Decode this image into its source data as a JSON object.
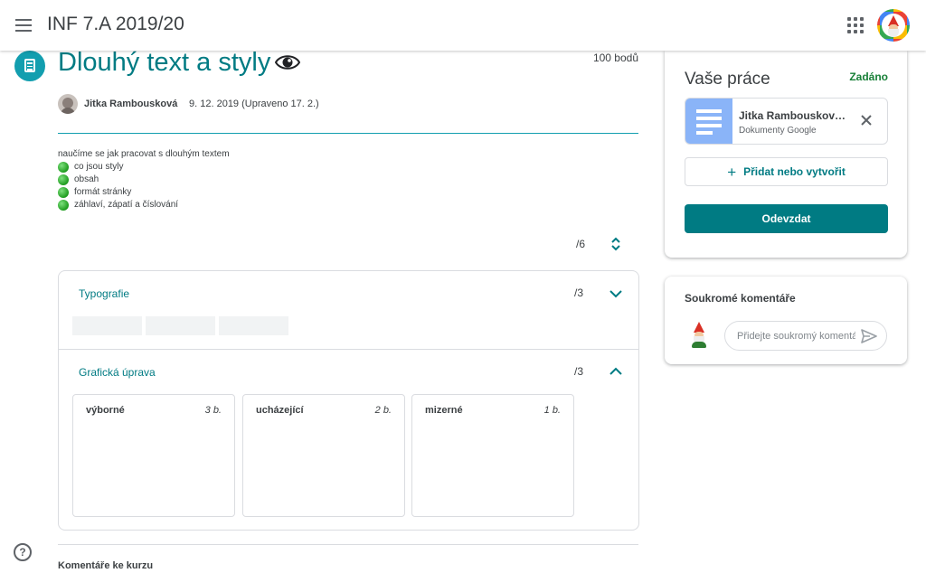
{
  "header": {
    "class_title": "INF 7.A 2019/20",
    "icons": {
      "menu": "menu-icon",
      "apps": "apps-grid-icon",
      "account": "account-avatar"
    }
  },
  "assignment": {
    "title": "Dlouhý text a styly",
    "points": "100 bodů",
    "author": "Jitka Rambousková",
    "date": "9. 12. 2019 (Upraveno 17. 2.)",
    "description_intro": "naučíme se jak pracovat s dlouhým textem",
    "bullets": [
      "co jsou styly",
      "obsah",
      "formát stránky",
      "záhlaví, zápatí a číslování"
    ]
  },
  "rubric": {
    "total": "/6",
    "criteria": [
      {
        "title": "Typografie",
        "score": "/3",
        "expanded": false
      },
      {
        "title": "Grafická úprava",
        "score": "/3",
        "expanded": true,
        "levels": [
          {
            "name": "výborné",
            "points": "3 b."
          },
          {
            "name": "ucházející",
            "points": "2 b."
          },
          {
            "name": "mizerné",
            "points": "1 b."
          }
        ]
      }
    ]
  },
  "course_comments": {
    "title": "Komentáře ke kurzu"
  },
  "your_work": {
    "title": "Vaše práce",
    "status": "Zadáno",
    "attachment": {
      "name": "Jitka Rambouskov…",
      "type": "Dokumenty Google"
    },
    "add_label": "Přidat nebo vytvořit",
    "submit_label": "Odevzdat"
  },
  "private_comments": {
    "title": "Soukromé komentáře",
    "placeholder": "Přidejte soukromý komentář…"
  },
  "colors": {
    "accent": "#007b83",
    "teal_icon": "#129eaf",
    "status_green": "#188038",
    "docs_blue": "#8ab4f8"
  }
}
